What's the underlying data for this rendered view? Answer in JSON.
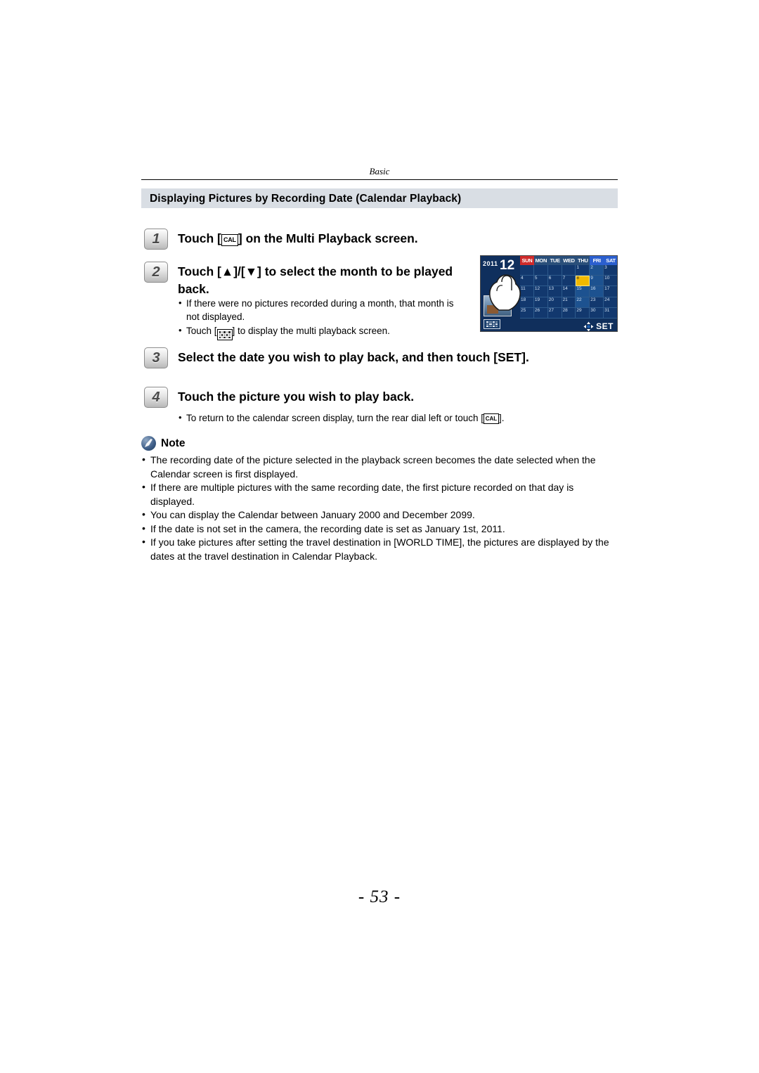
{
  "header": {
    "chapter": "Basic",
    "section_title": "Displaying Pictures by Recording Date (Calendar Playback)"
  },
  "steps": [
    {
      "num": "1",
      "text_before": "Touch [",
      "icon": "CAL",
      "text_after": "] on the Multi Playback screen."
    },
    {
      "num": "2",
      "text": "Touch [▲]/[▼] to select the month to be played back.",
      "bullets": [
        "If there were no pictures recorded during a month, that month is not displayed.",
        "Touch [multi-playback-icon] to display the multi playback screen."
      ],
      "bullet2_before": "Touch [",
      "bullet2_after": "] to display the multi playback screen."
    },
    {
      "num": "3",
      "text": "Select the date you wish to play back, and then touch [SET]."
    },
    {
      "num": "4",
      "text": "Touch the picture you wish to play back.",
      "bullet_before": "To return to the calendar screen display, turn the rear dial left or touch [",
      "bullet_icon": "CAL",
      "bullet_after": "]."
    }
  ],
  "note": {
    "label": "Note",
    "items": [
      "The recording date of the picture selected in the playback screen becomes the date selected when the Calendar screen is first displayed.",
      "If there are multiple pictures with the same recording date, the first picture recorded on that day is displayed.",
      "You can display the Calendar between January 2000 and December 2099.",
      "If the date is not set in the camera, the recording date is set as January 1st, 2011.",
      "If you take pictures after setting the travel destination in [WORLD TIME], the pictures are displayed by the dates at the travel destination in Calendar Playback."
    ]
  },
  "camera_screen": {
    "year": "2011",
    "month": "12",
    "weekdays": [
      "SUN",
      "MON",
      "TUE",
      "WED",
      "THU",
      "FRI",
      "SAT"
    ],
    "days_row1": [
      "",
      "",
      "",
      "",
      "1",
      "2",
      "3"
    ],
    "days_row2": [
      "4",
      "5",
      "6",
      "7",
      "8",
      "9",
      "10"
    ],
    "days_row3": [
      "11",
      "12",
      "13",
      "14",
      "15",
      "16",
      "17"
    ],
    "days_row4": [
      "18",
      "19",
      "20",
      "21",
      "22",
      "23",
      "24"
    ],
    "days_row5": [
      "25",
      "26",
      "27",
      "28",
      "29",
      "30",
      "31"
    ],
    "selected_day": "8",
    "days_with_pictures": [
      "2",
      "9",
      "15",
      "16",
      "22"
    ],
    "set_label": "SET"
  },
  "page_number": "- 53 -",
  "colors": {
    "section_bar": "#d9dee4",
    "screen_bg": "#12386e",
    "selected_day": "#f2b900",
    "sunday_header": "#cf2b2b",
    "saturday_header": "#2b5fcf"
  }
}
